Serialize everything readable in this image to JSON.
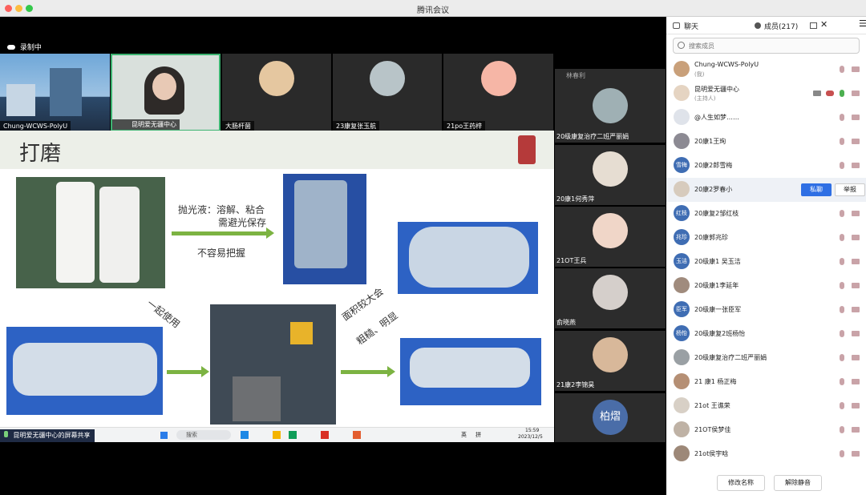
{
  "window": {
    "title": "腾讯会议"
  },
  "recording": {
    "label": "录制中"
  },
  "video_tiles": [
    {
      "name": "Chung-WCWS-PolyU"
    },
    {
      "name": "昆明爱无疆中心"
    },
    {
      "name": "大肠杆菌"
    },
    {
      "name": "23康复张玉航"
    },
    {
      "name": "21po王药梓"
    }
  ],
  "right_tiles": [
    {
      "name": "林春利"
    },
    {
      "name": "20级康复治疗二班严丽娟"
    },
    {
      "name": "20康1何秀萍"
    },
    {
      "name": "21OT王兵"
    },
    {
      "name": "俞晓燕"
    },
    {
      "name": "21康2李锦昊"
    },
    {
      "name": "柏熠"
    }
  ],
  "slide": {
    "title": "打磨",
    "text1": "抛光液：溶解、粘合",
    "text2": "需避光保存",
    "text3": "不容易把握",
    "text4": "一起使用",
    "text5": "面积较大会",
    "text6": "粗糙、明显"
  },
  "taskbar": {
    "search_placeholder": "搜索",
    "time": "15:59",
    "date": "2023/12/5",
    "lang": "英",
    "ime": "拼"
  },
  "share_bar": {
    "label": "昆明爱无疆中心的屏幕共享"
  },
  "panel": {
    "tab_chat": "聊天",
    "tab_members": "成员(217)",
    "search_placeholder": "搜索成员",
    "members": [
      {
        "name": "Chung-WCWS-PolyU",
        "sub": "(我)",
        "avatar": ""
      },
      {
        "name": "昆明爱无疆中心",
        "sub": "(主持人)",
        "avatar": ""
      },
      {
        "name": "@人生如梦……",
        "sub": "",
        "avatar": ""
      },
      {
        "name": "20康1王珣",
        "sub": "",
        "avatar": ""
      },
      {
        "name": "20康2郎雪梅",
        "sub": "",
        "avatar": "雪梅"
      },
      {
        "name": "20康2罗春小",
        "sub": "",
        "avatar": ""
      },
      {
        "name": "20康复2邹红枝",
        "sub": "",
        "avatar": "红枝"
      },
      {
        "name": "20康郭兆珍",
        "sub": "",
        "avatar": "兆珍"
      },
      {
        "name": "20级康1 吴玉洁",
        "sub": "",
        "avatar": "玉洁"
      },
      {
        "name": "20级康1李延年",
        "sub": "",
        "avatar": ""
      },
      {
        "name": "20级康一张臣军",
        "sub": "",
        "avatar": "臣军"
      },
      {
        "name": "20级康复2班杨怡",
        "sub": "",
        "avatar": "杨怡"
      },
      {
        "name": "20级康复治疗二班严丽娟",
        "sub": "",
        "avatar": ""
      },
      {
        "name": "21 康1 杨正梅",
        "sub": "",
        "avatar": ""
      },
      {
        "name": "21ot 王谯荣",
        "sub": "",
        "avatar": ""
      },
      {
        "name": "21OT侯梦佳",
        "sub": "",
        "avatar": ""
      },
      {
        "name": "21ot侯宇晗",
        "sub": "",
        "avatar": ""
      }
    ],
    "private_chat": "私聊",
    "report": "举报",
    "rename": "修改名称",
    "unmute": "解除静音"
  },
  "colors": {
    "accent": "#2f6fe4",
    "slide_arrow": "#7cb342",
    "mute_icon": "#c9a3a8"
  }
}
